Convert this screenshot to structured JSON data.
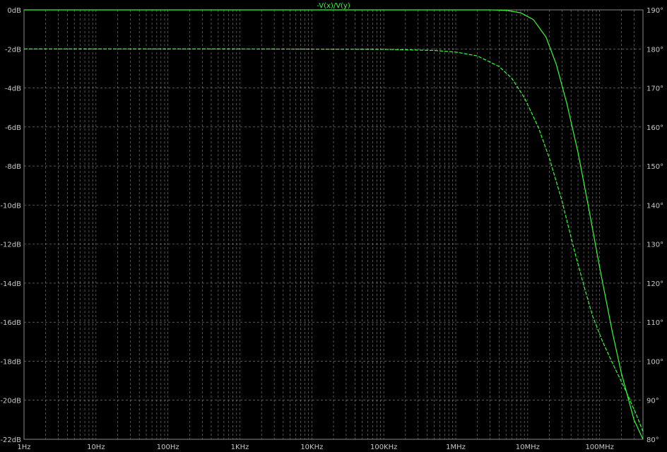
{
  "trace_title": "-V(x)/V(y)",
  "chart_data": {
    "type": "line",
    "x_scale": "log",
    "x_range_hz": [
      1,
      400000000
    ],
    "x_ticks": [
      {
        "value": 1,
        "label": "1Hz"
      },
      {
        "value": 10,
        "label": "10Hz"
      },
      {
        "value": 100,
        "label": "100Hz"
      },
      {
        "value": 1000,
        "label": "1KHz"
      },
      {
        "value": 10000,
        "label": "10KHz"
      },
      {
        "value": 100000,
        "label": "100KHz"
      },
      {
        "value": 1000000,
        "label": "1MHz"
      },
      {
        "value": 10000000,
        "label": "10MHz"
      },
      {
        "value": 100000000,
        "label": "100MHz"
      }
    ],
    "y_left_range_db": [
      -22,
      0
    ],
    "y_left_ticks": [
      {
        "value": 0,
        "label": "0dB"
      },
      {
        "value": -2,
        "label": "-2dB"
      },
      {
        "value": -4,
        "label": "-4dB"
      },
      {
        "value": -6,
        "label": "-6dB"
      },
      {
        "value": -8,
        "label": "-8dB"
      },
      {
        "value": -10,
        "label": "-10dB"
      },
      {
        "value": -12,
        "label": "-12dB"
      },
      {
        "value": -14,
        "label": "-14dB"
      },
      {
        "value": -16,
        "label": "-16dB"
      },
      {
        "value": -18,
        "label": "-18dB"
      },
      {
        "value": -20,
        "label": "-20dB"
      },
      {
        "value": -22,
        "label": "-22dB"
      }
    ],
    "y_right_range_deg": [
      80,
      190
    ],
    "y_right_ticks": [
      {
        "value": 190,
        "label": "190°"
      },
      {
        "value": 180,
        "label": "180°"
      },
      {
        "value": 170,
        "label": "170°"
      },
      {
        "value": 160,
        "label": "160°"
      },
      {
        "value": 150,
        "label": "150°"
      },
      {
        "value": 140,
        "label": "140°"
      },
      {
        "value": 130,
        "label": "130°"
      },
      {
        "value": 120,
        "label": "120°"
      },
      {
        "value": 110,
        "label": "110°"
      },
      {
        "value": 100,
        "label": "100°"
      },
      {
        "value": 90,
        "label": "90°"
      },
      {
        "value": 80,
        "label": "80°"
      }
    ],
    "series": [
      {
        "axis": "left_db",
        "style": "solid",
        "color": "#33ff33",
        "points": [
          [
            1,
            0
          ],
          [
            1000,
            0
          ],
          [
            1000000,
            0
          ],
          [
            3000000,
            0
          ],
          [
            5000000,
            -0.02
          ],
          [
            8000000,
            -0.15
          ],
          [
            12000000,
            -0.5
          ],
          [
            18000000,
            -1.4
          ],
          [
            25000000,
            -2.8
          ],
          [
            35000000,
            -4.8
          ],
          [
            50000000,
            -7.3
          ],
          [
            70000000,
            -10.1
          ],
          [
            100000000,
            -13.2
          ],
          [
            150000000,
            -16.5
          ],
          [
            200000000,
            -18.6
          ],
          [
            300000000,
            -21.0
          ],
          [
            400000000,
            -22.0
          ]
        ]
      },
      {
        "axis": "right_deg",
        "style": "dashed",
        "color": "#33ff33",
        "points": [
          [
            1,
            180
          ],
          [
            1000,
            180
          ],
          [
            100000,
            179.9
          ],
          [
            500000,
            179.6
          ],
          [
            1000000,
            179.2
          ],
          [
            2000000,
            178.2
          ],
          [
            4000000,
            175.5
          ],
          [
            6000000,
            172.5
          ],
          [
            9000000,
            167.5
          ],
          [
            14000000,
            160
          ],
          [
            20000000,
            152
          ],
          [
            30000000,
            141
          ],
          [
            45000000,
            128
          ],
          [
            60000000,
            119.5
          ],
          [
            80000000,
            111.5
          ],
          [
            110000000,
            105
          ],
          [
            160000000,
            98.5
          ],
          [
            230000000,
            92.5
          ],
          [
            320000000,
            86.5
          ],
          [
            400000000,
            82
          ]
        ]
      }
    ],
    "grid": true
  }
}
